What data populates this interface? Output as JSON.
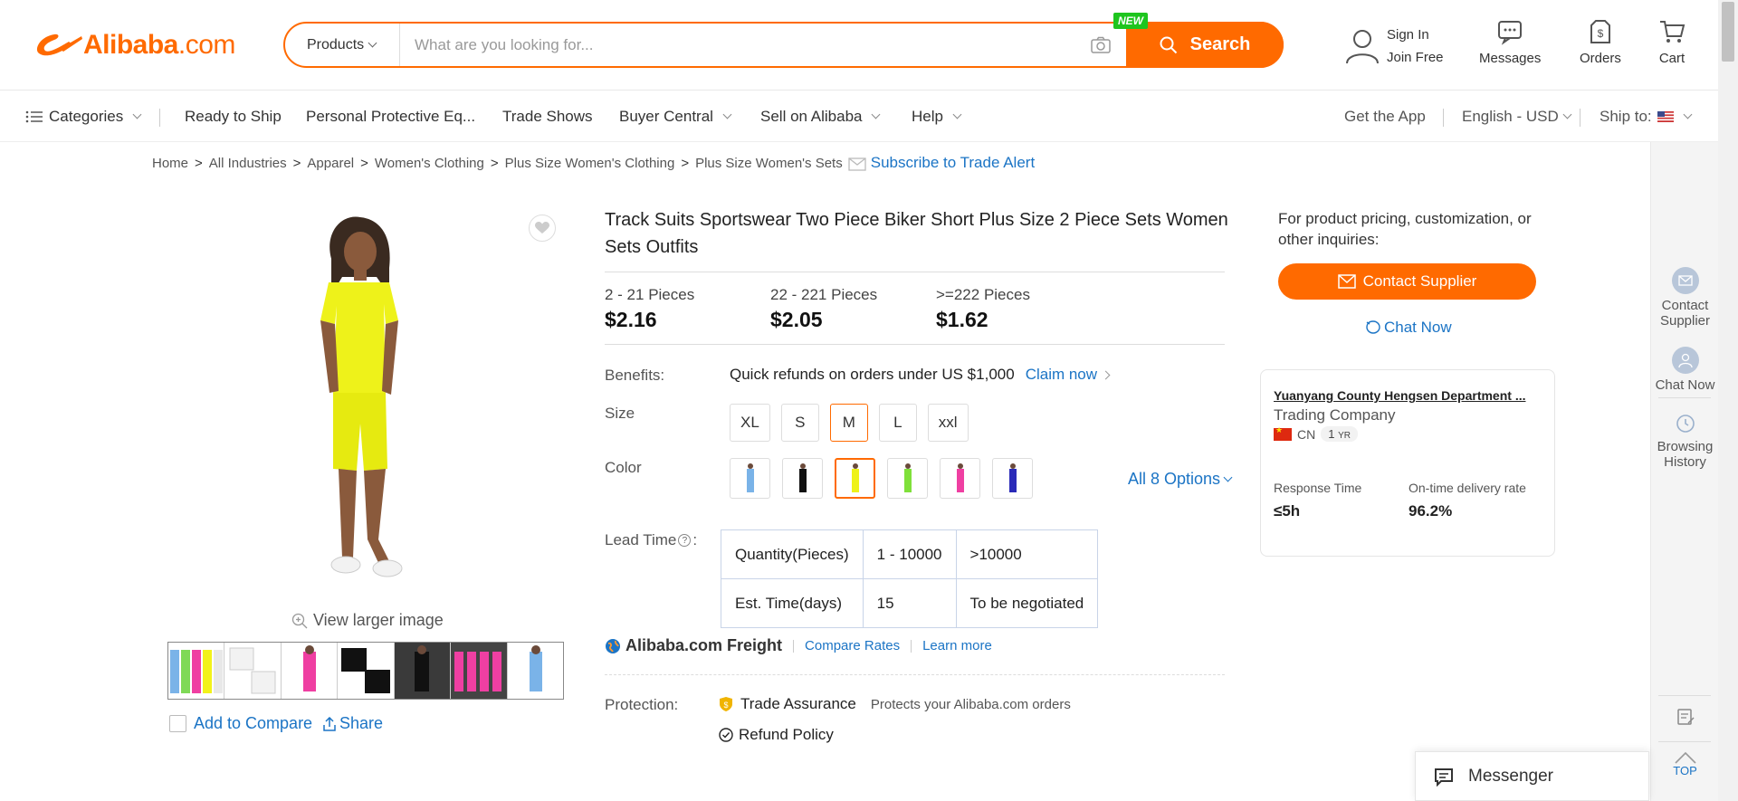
{
  "header": {
    "logo_brand": "Alibaba",
    "logo_suffix": ".com",
    "search_category": "Products",
    "search_placeholder": "What are you looking for...",
    "new_badge": "NEW",
    "search_button": "Search",
    "sign_in": "Sign In",
    "join_free": "Join Free",
    "messages": "Messages",
    "orders": "Orders",
    "cart": "Cart"
  },
  "nav": {
    "categories": "Categories",
    "ready_to_ship": "Ready to Ship",
    "ppe": "Personal Protective Eq...",
    "trade_shows": "Trade Shows",
    "buyer_central": "Buyer Central",
    "sell_on_alibaba": "Sell on Alibaba",
    "help": "Help",
    "get_app": "Get the App",
    "language": "English - USD",
    "ship_to": "Ship to:"
  },
  "breadcrumb": {
    "items": [
      "Home",
      "All Industries",
      "Apparel",
      "Women's Clothing",
      "Plus Size Women's Clothing",
      "Plus Size Women's Sets"
    ],
    "separator": ">",
    "subscribe": "Subscribe to Trade Alert"
  },
  "gallery": {
    "view_larger": "View larger image",
    "add_to_compare": "Add to Compare",
    "share": "Share"
  },
  "product": {
    "title": "Track Suits Sportswear Two Piece Biker Short Plus Size 2 Piece Sets Women Sets Outfits",
    "price_tiers": [
      {
        "quantity": "2 - 21 Pieces",
        "price": "$2.16"
      },
      {
        "quantity": "22 - 221 Pieces",
        "price": "$2.05"
      },
      {
        "quantity": ">=222 Pieces",
        "price": "$1.62"
      }
    ],
    "benefits_label": "Benefits:",
    "benefits_text": "Quick refunds on orders under US $1,000",
    "claim_now": "Claim now",
    "size_label": "Size",
    "sizes": [
      "XL",
      "S",
      "M",
      "L",
      "xxl"
    ],
    "selected_size": "M",
    "color_label": "Color",
    "all_options": "All 8 Options",
    "lead_time_label": "Lead Time",
    "lead_time_colon": ":",
    "lead_time_help": "?",
    "lead_table": {
      "row1": [
        "Quantity(Pieces)",
        "1 - 10000",
        ">10000"
      ],
      "row2": [
        "Est. Time(days)",
        "15",
        "To be negotiated"
      ]
    },
    "freight_brand": "Alibaba.com Freight",
    "compare_rates": "Compare Rates",
    "learn_more": "Learn more",
    "protection_label": "Protection:",
    "trade_assurance": "Trade Assurance",
    "trade_assurance_desc": "Protects your Alibaba.com orders",
    "refund_policy": "Refund Policy"
  },
  "supplier": {
    "inquiry_text": "For product pricing, customization, or other inquiries:",
    "contact_button": "Contact Supplier",
    "chat_now": "Chat Now",
    "name": "Yuanyang County Hengsen Department ...",
    "type": "Trading Company",
    "country": "CN",
    "years": "1",
    "years_unit": "YR",
    "response_time_label": "Response Time",
    "response_time": "≤5h",
    "ontime_label": "On-time delivery rate",
    "ontime_value": "96.2%"
  },
  "sidebar": {
    "contact_supplier": "Contact Supplier",
    "chat_now": "Chat Now",
    "browsing_history": "Browsing History",
    "top": "TOP"
  },
  "messenger": {
    "label": "Messenger"
  },
  "colors": {
    "accent": "#ff6a00",
    "link": "#1b74c5",
    "new_badge": "#1ec51e",
    "product_yellow": "#eef21a"
  }
}
